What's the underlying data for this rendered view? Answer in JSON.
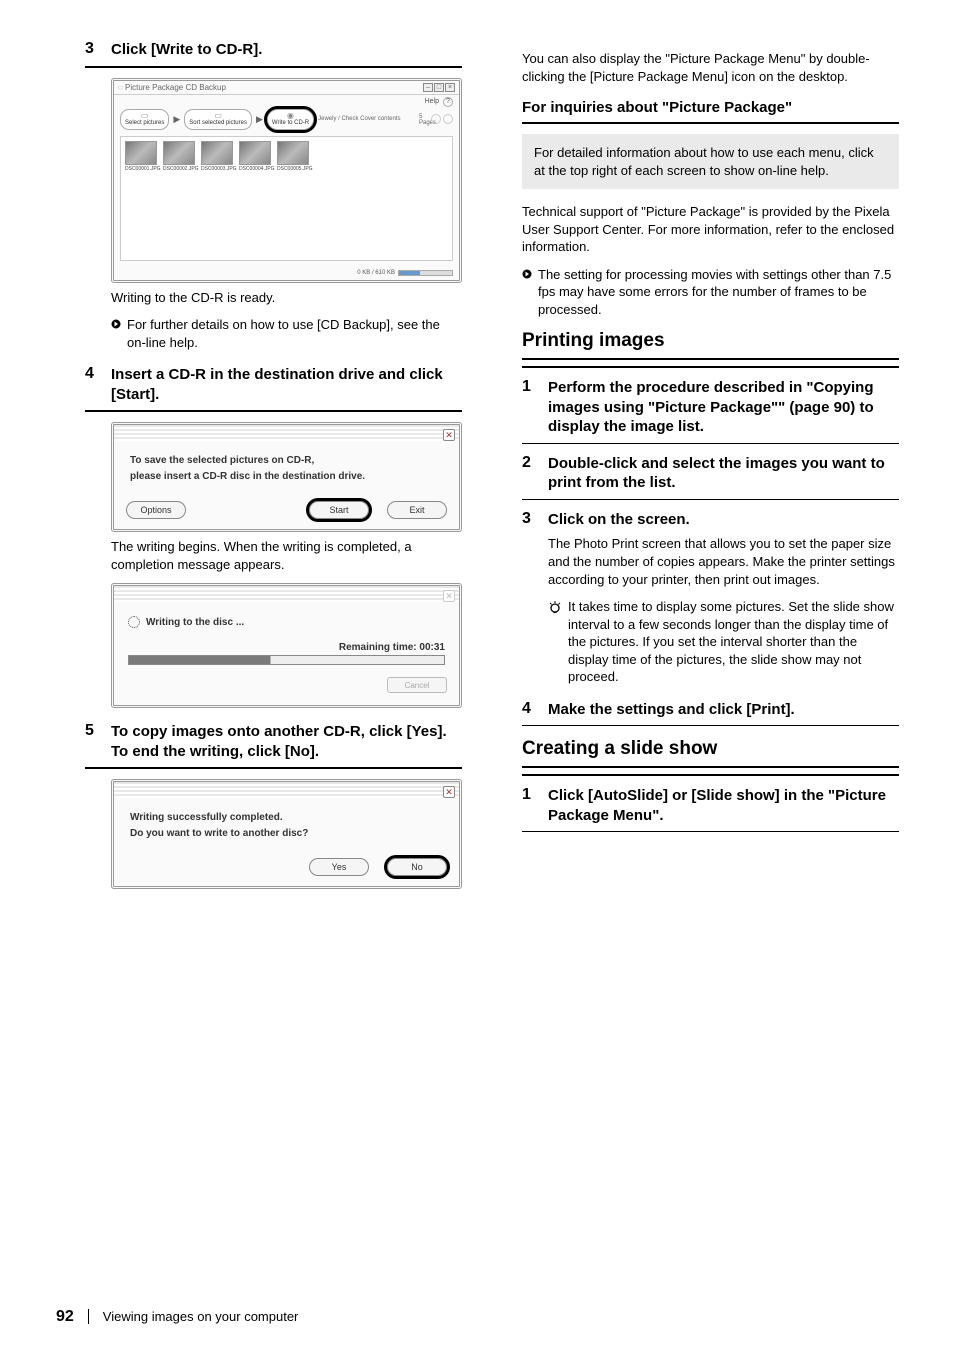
{
  "leftColumn": {
    "step3": {
      "num": "3",
      "text": "Click [Write to CD-R]."
    },
    "shotA": {
      "title": "Picture Package CD Backup",
      "helpLabel": "Help",
      "pills": {
        "p1": {
          "icon": "▭",
          "label": "Select pictures"
        },
        "p2": {
          "icon": "▭",
          "label": "Sort selected pictures"
        },
        "p3": {
          "icon": "◉",
          "label": "Write to CD-R"
        }
      },
      "labelRight": "Jewely / Check Cover contents",
      "navCount": "5 Pages",
      "thumbs": [
        "DSC00001.JPG",
        "DSC00002.JPG",
        "DSC00003.JPG",
        "DSC00004.JPG",
        "DSC00005.JPG"
      ],
      "status": "0 KB / 610 KB"
    },
    "step3Body": "Writing to the CD-R is ready.",
    "note3": "For further details on how to use [CD Backup], see the on-line help.",
    "step4": {
      "num": "4",
      "text": "Insert a CD-R in the destination drive and click [Start]."
    },
    "shotB": {
      "line1": "To save the selected pictures on CD-R,",
      "line2": "please insert a CD-R disc in the destination drive.",
      "btnOptions": "Options",
      "btnStart": "Start",
      "btnExit": "Exit"
    },
    "step4Body": "The writing begins. When the writing is completed, a completion message appears.",
    "shotC": {
      "writing": "Writing to the disc ...",
      "remaining": "Remaining  time: 00:31",
      "cancel": "Cancel"
    },
    "step5": {
      "num": "5",
      "text": "To copy images onto another CD-R, click [Yes]. To end the writing, click [No]."
    },
    "shotD": {
      "line1": "Writing successfully completed.",
      "line2": "Do you want to write to another disc?",
      "btnYes": "Yes",
      "btnNo": "No"
    }
  },
  "rightColumn": {
    "line1": "You can also display the \"Picture Package Menu\" by double-clicking the [Picture Package Menu] icon on the desktop.",
    "heading1": "For inquiries about \"Picture Package\"",
    "tipBody": "For detailed information about how to use each menu, click  at the top right of each screen to show on-line help.",
    "tipFooter": "Technical support of \"Picture Package\" is provided by the Pixela User Support Center. For more information, refer to the enclosed information.",
    "note2": "The setting for processing movies with settings other than 7.5 fps may have some errors for the number of frames to be processed.",
    "heading2": "Printing images",
    "step1": {
      "num": "1",
      "text": "Perform the procedure described in \"Copying images using \"Picture Package\"\" (page 90) to display the image list."
    },
    "step2": {
      "num": "2",
      "text": "Double-click and select the images you want to print from the list."
    },
    "step3r": {
      "num": "3",
      "text": "Click  on the screen."
    },
    "step3rBody": "The Photo Print screen that allows you to set the paper size and the number of copies appears. Make the printer settings according to your printer, then print out images.",
    "tip2": "It takes time to display some pictures. Set the slide show interval to a few seconds longer than the display time of the pictures. If you set the interval shorter than the display time of the pictures, the slide show may not proceed.",
    "step4r": {
      "num": "4",
      "text": "Make the settings and click [Print]."
    },
    "heading3": "Creating a slide show",
    "step1s": {
      "num": "1",
      "text": "Click [AutoSlide] or [Slide show] in the \"Picture Package Menu\"."
    }
  },
  "footer": {
    "page": "92",
    "crumb": "Viewing images on your computer"
  }
}
